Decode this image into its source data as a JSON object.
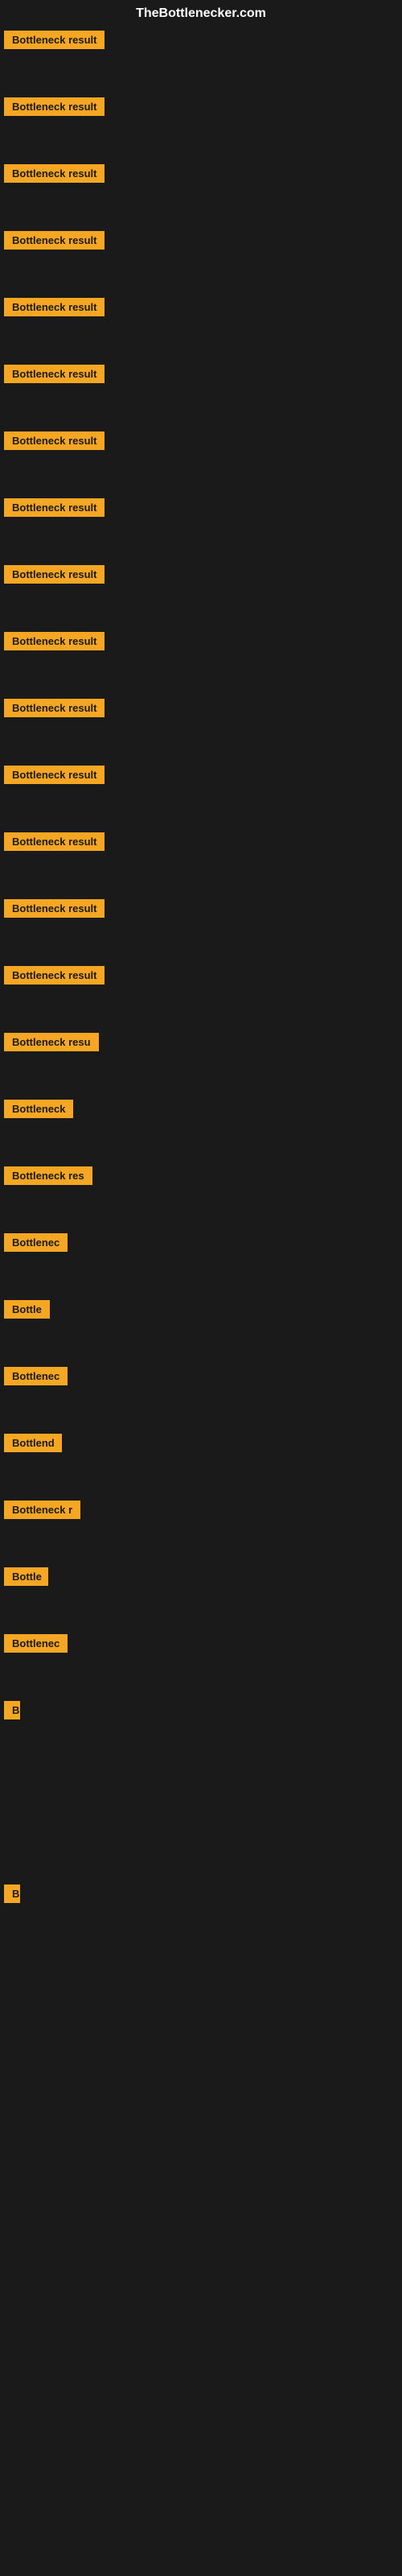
{
  "site": {
    "title": "TheBottlenecker.com"
  },
  "colors": {
    "background": "#1a1a1a",
    "label_bg": "#f5a623",
    "label_text": "#1a1a1a",
    "title_text": "#ffffff"
  },
  "items": [
    {
      "id": 1,
      "label": "Bottleneck result",
      "width": 140,
      "spacer_after": 55
    },
    {
      "id": 2,
      "label": "Bottleneck result",
      "width": 140,
      "spacer_after": 55
    },
    {
      "id": 3,
      "label": "Bottleneck result",
      "width": 140,
      "spacer_after": 55
    },
    {
      "id": 4,
      "label": "Bottleneck result",
      "width": 140,
      "spacer_after": 55
    },
    {
      "id": 5,
      "label": "Bottleneck result",
      "width": 140,
      "spacer_after": 55
    },
    {
      "id": 6,
      "label": "Bottleneck result",
      "width": 140,
      "spacer_after": 55
    },
    {
      "id": 7,
      "label": "Bottleneck result",
      "width": 140,
      "spacer_after": 55
    },
    {
      "id": 8,
      "label": "Bottleneck result",
      "width": 140,
      "spacer_after": 55
    },
    {
      "id": 9,
      "label": "Bottleneck result",
      "width": 140,
      "spacer_after": 55
    },
    {
      "id": 10,
      "label": "Bottleneck result",
      "width": 140,
      "spacer_after": 55
    },
    {
      "id": 11,
      "label": "Bottleneck result",
      "width": 140,
      "spacer_after": 55
    },
    {
      "id": 12,
      "label": "Bottleneck result",
      "width": 140,
      "spacer_after": 55
    },
    {
      "id": 13,
      "label": "Bottleneck result",
      "width": 140,
      "spacer_after": 55
    },
    {
      "id": 14,
      "label": "Bottleneck result",
      "width": 140,
      "spacer_after": 55
    },
    {
      "id": 15,
      "label": "Bottleneck result",
      "width": 140,
      "spacer_after": 55
    },
    {
      "id": 16,
      "label": "Bottleneck resu",
      "width": 120,
      "spacer_after": 55
    },
    {
      "id": 17,
      "label": "Bottleneck",
      "width": 90,
      "spacer_after": 55
    },
    {
      "id": 18,
      "label": "Bottleneck res",
      "width": 110,
      "spacer_after": 55
    },
    {
      "id": 19,
      "label": "Bottlenec",
      "width": 80,
      "spacer_after": 55
    },
    {
      "id": 20,
      "label": "Bottle",
      "width": 60,
      "spacer_after": 55
    },
    {
      "id": 21,
      "label": "Bottlenec",
      "width": 80,
      "spacer_after": 55
    },
    {
      "id": 22,
      "label": "Bottlend",
      "width": 72,
      "spacer_after": 55
    },
    {
      "id": 23,
      "label": "Bottleneck r",
      "width": 95,
      "spacer_after": 55
    },
    {
      "id": 24,
      "label": "Bottle",
      "width": 55,
      "spacer_after": 55
    },
    {
      "id": 25,
      "label": "Bottlenec",
      "width": 80,
      "spacer_after": 55
    },
    {
      "id": 26,
      "label": "B",
      "width": 20,
      "spacer_after": 200
    },
    {
      "id": 27,
      "label": "",
      "width": 0,
      "spacer_after": 200
    },
    {
      "id": 28,
      "label": "",
      "width": 0,
      "spacer_after": 200
    },
    {
      "id": 29,
      "label": "B",
      "width": 20,
      "spacer_after": 200
    },
    {
      "id": 30,
      "label": "",
      "width": 0,
      "spacer_after": 200
    },
    {
      "id": 31,
      "label": "",
      "width": 0,
      "spacer_after": 200
    }
  ]
}
